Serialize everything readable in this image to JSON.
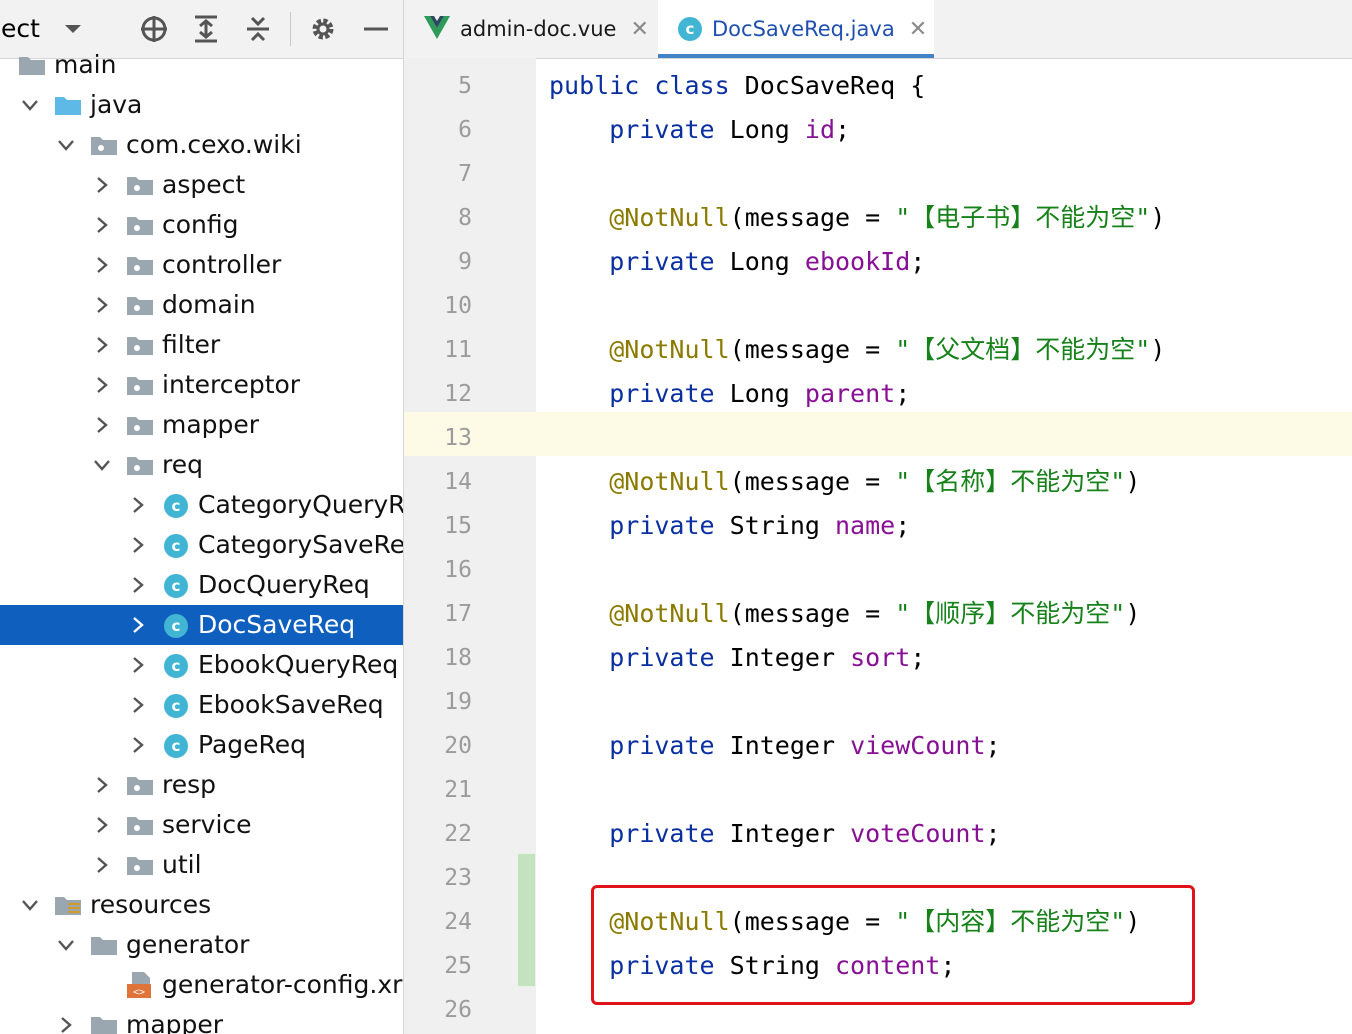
{
  "project_panel": {
    "title": "ject",
    "tree": [
      {
        "label": "main",
        "type": "folder-gray",
        "expanded": null
      },
      {
        "label": "java",
        "type": "folder-blue",
        "expanded": true
      },
      {
        "label": "com.cexo.wiki",
        "type": "package",
        "expanded": true
      },
      {
        "label": "aspect",
        "type": "package",
        "expanded": false
      },
      {
        "label": "config",
        "type": "package",
        "expanded": false
      },
      {
        "label": "controller",
        "type": "package",
        "expanded": false
      },
      {
        "label": "domain",
        "type": "package",
        "expanded": false
      },
      {
        "label": "filter",
        "type": "package",
        "expanded": false
      },
      {
        "label": "interceptor",
        "type": "package",
        "expanded": false
      },
      {
        "label": "mapper",
        "type": "package",
        "expanded": false
      },
      {
        "label": "req",
        "type": "package",
        "expanded": true
      },
      {
        "label": "CategoryQueryR",
        "type": "class",
        "expanded": false
      },
      {
        "label": "CategorySaveRe",
        "type": "class",
        "expanded": false
      },
      {
        "label": "DocQueryReq",
        "type": "class",
        "expanded": false
      },
      {
        "label": "DocSaveReq",
        "type": "class",
        "expanded": false,
        "selected": true
      },
      {
        "label": "EbookQueryReq",
        "type": "class",
        "expanded": false
      },
      {
        "label": "EbookSaveReq",
        "type": "class",
        "expanded": false
      },
      {
        "label": "PageReq",
        "type": "class",
        "expanded": false
      },
      {
        "label": "resp",
        "type": "package",
        "expanded": false
      },
      {
        "label": "service",
        "type": "package",
        "expanded": false
      },
      {
        "label": "util",
        "type": "package",
        "expanded": false
      },
      {
        "label": "resources",
        "type": "resources-folder",
        "expanded": true
      },
      {
        "label": "generator",
        "type": "folder-gray",
        "expanded": true
      },
      {
        "label": "generator-config.xr",
        "type": "xml-file",
        "expanded": null
      },
      {
        "label": "mapper",
        "type": "folder-gray",
        "expanded": false
      }
    ]
  },
  "tabs": [
    {
      "label": "admin-doc.vue",
      "icon": "vue-icon",
      "active": false
    },
    {
      "label": "DocSaveReq.java",
      "icon": "class-icon",
      "active": true
    }
  ],
  "icon_letter": "c",
  "editor": {
    "current_line": 13,
    "lines": [
      {
        "no": "5",
        "tokens": [
          [
            "kw",
            "public class "
          ],
          [
            "",
            "DocSaveReq {"
          ]
        ]
      },
      {
        "no": "6",
        "tokens": [
          [
            "",
            "    "
          ],
          [
            "kw",
            "private "
          ],
          [
            "",
            "Long "
          ],
          [
            "fld",
            "id"
          ],
          [
            "",
            ";"
          ]
        ]
      },
      {
        "no": "7",
        "tokens": []
      },
      {
        "no": "8",
        "tokens": [
          [
            "",
            "    "
          ],
          [
            "ann",
            "@NotNull"
          ],
          [
            "",
            "(message = "
          ],
          [
            "str",
            "\"【电子书】不能为空\""
          ],
          [
            "",
            ")"
          ]
        ]
      },
      {
        "no": "9",
        "tokens": [
          [
            "",
            "    "
          ],
          [
            "kw",
            "private "
          ],
          [
            "",
            "Long "
          ],
          [
            "fld",
            "ebookId"
          ],
          [
            "",
            ";"
          ]
        ]
      },
      {
        "no": "10",
        "tokens": []
      },
      {
        "no": "11",
        "tokens": [
          [
            "",
            "    "
          ],
          [
            "ann",
            "@NotNull"
          ],
          [
            "",
            "(message = "
          ],
          [
            "str",
            "\"【父文档】不能为空\""
          ],
          [
            "",
            ")"
          ]
        ]
      },
      {
        "no": "12",
        "tokens": [
          [
            "",
            "    "
          ],
          [
            "kw",
            "private "
          ],
          [
            "",
            "Long "
          ],
          [
            "fld",
            "parent"
          ],
          [
            "",
            ";"
          ]
        ]
      },
      {
        "no": "13",
        "tokens": []
      },
      {
        "no": "14",
        "tokens": [
          [
            "",
            "    "
          ],
          [
            "ann",
            "@NotNull"
          ],
          [
            "",
            "(message = "
          ],
          [
            "str",
            "\"【名称】不能为空\""
          ],
          [
            "",
            ")"
          ]
        ]
      },
      {
        "no": "15",
        "tokens": [
          [
            "",
            "    "
          ],
          [
            "kw",
            "private "
          ],
          [
            "",
            "String "
          ],
          [
            "fld",
            "name"
          ],
          [
            "",
            ";"
          ]
        ]
      },
      {
        "no": "16",
        "tokens": []
      },
      {
        "no": "17",
        "tokens": [
          [
            "",
            "    "
          ],
          [
            "ann",
            "@NotNull"
          ],
          [
            "",
            "(message = "
          ],
          [
            "str",
            "\"【顺序】不能为空\""
          ],
          [
            "",
            ")"
          ]
        ]
      },
      {
        "no": "18",
        "tokens": [
          [
            "",
            "    "
          ],
          [
            "kw",
            "private "
          ],
          [
            "",
            "Integer "
          ],
          [
            "fld",
            "sort"
          ],
          [
            "",
            ";"
          ]
        ]
      },
      {
        "no": "19",
        "tokens": []
      },
      {
        "no": "20",
        "tokens": [
          [
            "",
            "    "
          ],
          [
            "kw",
            "private "
          ],
          [
            "",
            "Integer "
          ],
          [
            "fld",
            "viewCount"
          ],
          [
            "",
            ";"
          ]
        ]
      },
      {
        "no": "21",
        "tokens": []
      },
      {
        "no": "22",
        "tokens": [
          [
            "",
            "    "
          ],
          [
            "kw",
            "private "
          ],
          [
            "",
            "Integer "
          ],
          [
            "fld",
            "voteCount"
          ],
          [
            "",
            ";"
          ]
        ]
      },
      {
        "no": "23",
        "tokens": []
      },
      {
        "no": "24",
        "tokens": [
          [
            "",
            "    "
          ],
          [
            "ann",
            "@NotNull"
          ],
          [
            "",
            "(message = "
          ],
          [
            "str",
            "\"【内容】不能为空\""
          ],
          [
            "",
            ")"
          ]
        ]
      },
      {
        "no": "25",
        "tokens": [
          [
            "",
            "    "
          ],
          [
            "kw",
            "private "
          ],
          [
            "",
            "String "
          ],
          [
            "fld",
            "content"
          ],
          [
            "",
            ";"
          ]
        ]
      },
      {
        "no": "26",
        "tokens": []
      }
    ]
  },
  "colors": {
    "selection": "#0f5fbe",
    "keyword": "#0a2fa0",
    "annotation": "#8b7a00",
    "string": "#17821a",
    "field": "#871094",
    "highlight_box": "#e0131a"
  }
}
